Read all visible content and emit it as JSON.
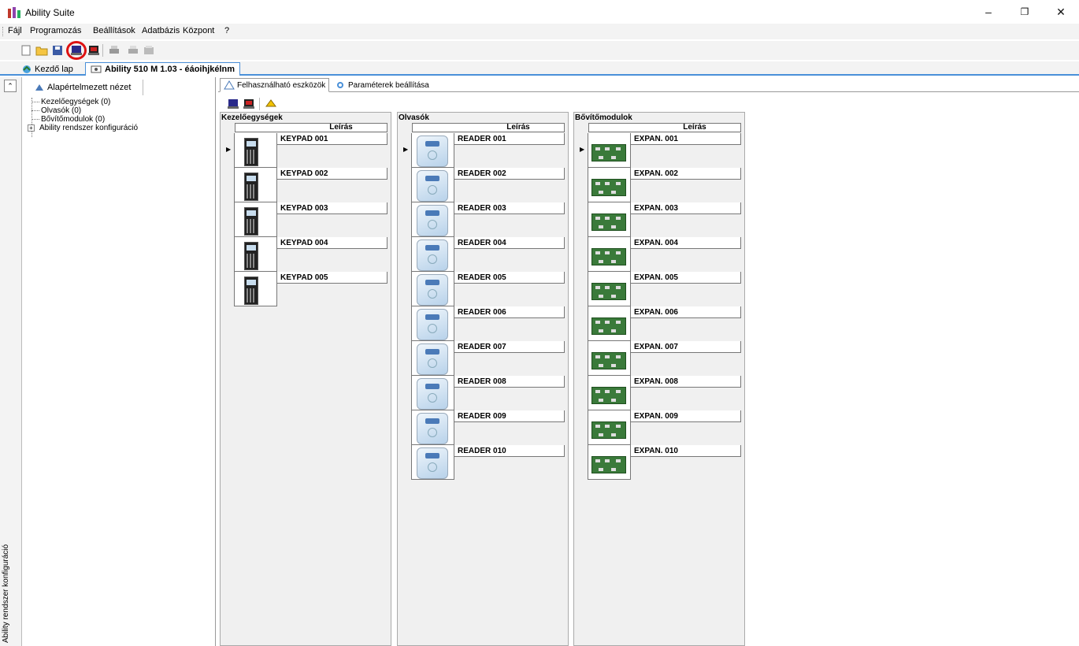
{
  "window": {
    "title": "Ability Suite",
    "icons": [
      "app-logo-icon",
      "minimize-icon",
      "restore-icon",
      "close-icon"
    ]
  },
  "menu": {
    "items": [
      "Fájl",
      "Programozás",
      "Beállítások",
      "Adatbázis",
      "Központ",
      "?"
    ]
  },
  "toolbar": {
    "buttons": [
      "new-icon",
      "open-icon",
      "save-icon",
      "read-from-panel-icon",
      "write-to-panel-icon",
      "print-icon",
      "print-preview-icon",
      "export-icon"
    ],
    "highlighted": "read-from-panel-icon",
    "highlight_color": "#d11111"
  },
  "doctabs": [
    {
      "label": "Kezdő lap",
      "icon": "home-icon"
    },
    {
      "label": "Ability 510 M 1.03 - éáoihjkélnm",
      "icon": "panel-icon",
      "active": true
    }
  ],
  "sidebar": {
    "view_label": "Alapértelmezett nézet",
    "vertical_label": "Ability rendszer konfiguráció",
    "tree": [
      {
        "label": "Kezelőegységek (0)"
      },
      {
        "label": "Olvasók (0)"
      },
      {
        "label": "Bővítőmodulok (0)"
      },
      {
        "label": "Ability rendszer konfiguráció",
        "expandable": true
      }
    ]
  },
  "subtabs": [
    {
      "label": "Felhasználható eszközök",
      "icon": "devices-icon",
      "active": true
    },
    {
      "label": "Paraméterek beállítása",
      "icon": "settings-icon"
    }
  ],
  "panels": {
    "keypads": {
      "title": "Kezelőegységek",
      "column": "Leírás",
      "items": [
        "KEYPAD 001",
        "KEYPAD 002",
        "KEYPAD 003",
        "KEYPAD 004",
        "KEYPAD 005"
      ]
    },
    "readers": {
      "title": "Olvasók",
      "column": "Leírás",
      "items": [
        "READER  001",
        "READER  002",
        "READER  003",
        "READER  004",
        "READER  005",
        "READER  006",
        "READER  007",
        "READER  008",
        "READER  009",
        "READER  010"
      ]
    },
    "expanders": {
      "title": "Bővítőmodulok",
      "column": "Leírás",
      "items": [
        "EXPAN. 001",
        "EXPAN. 002",
        "EXPAN. 003",
        "EXPAN. 004",
        "EXPAN. 005",
        "EXPAN. 006",
        "EXPAN. 007",
        "EXPAN. 008",
        "EXPAN. 009",
        "EXPAN. 010"
      ]
    }
  }
}
